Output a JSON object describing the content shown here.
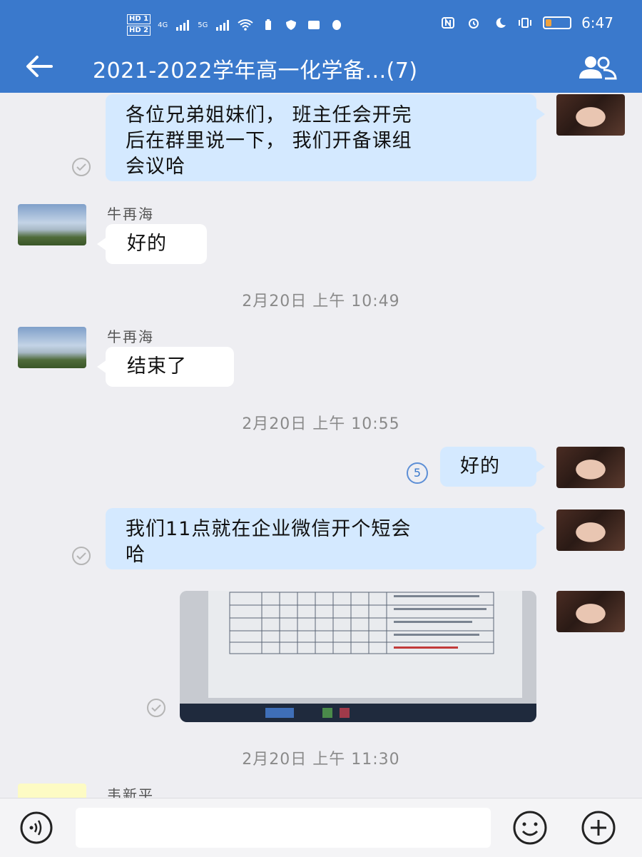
{
  "status_bar": {
    "time": "6:47",
    "hd_top": "HD 1",
    "hd_bottom": "HD 2",
    "signal1_label": "4G",
    "signal2_label": "5G",
    "battery_level": 0.25,
    "battery_color": "#f0a23c"
  },
  "header": {
    "title": "2021-2022学年高一化学备...(7)",
    "background_color": "#3a79cc"
  },
  "messages": [
    {
      "from": "me",
      "text": "各位兄弟姐妹们， 班主任会开完后在群里说一下， 我们开备课组会议哈",
      "lines": [
        "各位兄弟姐妹们， 班主任会开完",
        "后在群里说一下， 我们开备课组",
        "会议哈"
      ]
    },
    {
      "from": "牛再海",
      "text": "好的"
    },
    {
      "timestamp": "2月20日  上午 10:49"
    },
    {
      "from": "牛再海",
      "text": "结束了"
    },
    {
      "timestamp": "2月20日  上午 10:55"
    },
    {
      "from": "me",
      "text": "好的",
      "read_count": "5"
    },
    {
      "from": "me",
      "text": "我们11点就在企业微信开个短会哈",
      "lines": [
        "我们11点就在企业微信开个短会",
        "哈"
      ]
    },
    {
      "from": "me",
      "type": "image",
      "image_desc": "photo-of-spreadsheet-on-monitor"
    },
    {
      "timestamp": "2月20日  上午 11:30"
    },
    {
      "from": "韦新平",
      "partial": true
    }
  ],
  "input": {
    "placeholder": "",
    "value": ""
  },
  "icons": {
    "back": "back-arrow-icon",
    "members": "group-members-icon",
    "voice": "voice-input-icon",
    "emoji": "emoji-icon",
    "plus": "plus-icon"
  }
}
